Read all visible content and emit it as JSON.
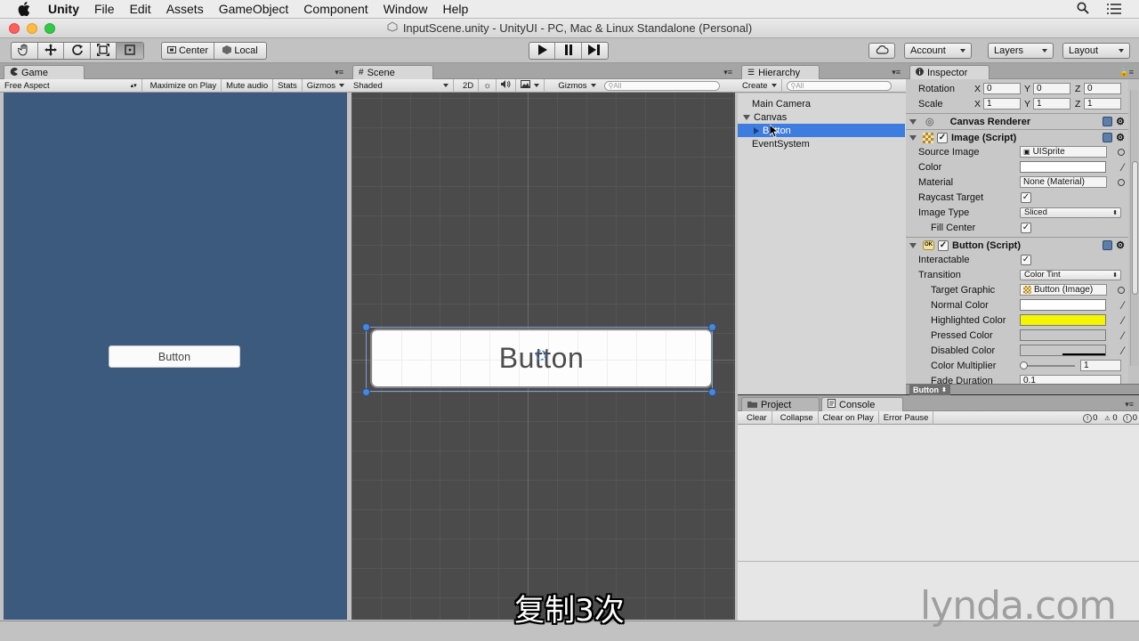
{
  "menubar": {
    "app": "Unity",
    "items": [
      "File",
      "Edit",
      "Assets",
      "GameObject",
      "Component",
      "Window",
      "Help"
    ]
  },
  "window": {
    "title": "InputScene.unity - UnityUI - PC, Mac & Linux Standalone (Personal)"
  },
  "toolbar": {
    "pivot": "Center",
    "space": "Local",
    "account": "Account",
    "layers": "Layers",
    "layout": "Layout"
  },
  "game": {
    "tab": "Game",
    "aspect": "Free Aspect",
    "maximize": "Maximize on Play",
    "mute": "Mute audio",
    "stats": "Stats",
    "gizmos": "Gizmos",
    "button_text": "Button"
  },
  "scene": {
    "tab": "Scene",
    "shading": "Shaded",
    "mode2d": "2D",
    "gizmos": "Gizmos",
    "search_placeholder": "All",
    "button_text": "Button"
  },
  "hierarchy": {
    "tab": "Hierarchy",
    "create": "Create",
    "search_placeholder": "All",
    "items": [
      {
        "label": "Main Camera"
      },
      {
        "label": "Canvas"
      },
      {
        "label": "Button"
      },
      {
        "label": "EventSystem"
      }
    ]
  },
  "inspector": {
    "tab": "Inspector",
    "rotation": {
      "label": "Rotation",
      "x": "0",
      "y": "0",
      "z": "0"
    },
    "scale": {
      "label": "Scale",
      "x": "1",
      "y": "1",
      "z": "1"
    },
    "axis": {
      "x": "X",
      "y": "Y",
      "z": "Z"
    },
    "canvas_renderer": "Canvas Renderer",
    "image_script": {
      "title": "Image (Script)",
      "source_image_label": "Source Image",
      "source_image_value": "UISprite",
      "color_label": "Color",
      "material_label": "Material",
      "material_value": "None (Material)",
      "raycast_label": "Raycast Target",
      "image_type_label": "Image Type",
      "image_type_value": "Sliced",
      "fill_center_label": "Fill Center"
    },
    "button_script": {
      "title": "Button (Script)",
      "interactable_label": "Interactable",
      "transition_label": "Transition",
      "transition_value": "Color Tint",
      "target_graphic_label": "Target Graphic",
      "target_graphic_value": "Button (Image)",
      "normal_color_label": "Normal Color",
      "highlighted_color_label": "Highlighted Color",
      "pressed_color_label": "Pressed Color",
      "disabled_color_label": "Disabled Color",
      "color_multiplier_label": "Color Multiplier",
      "color_multiplier_value": "1",
      "fade_duration_label": "Fade Duration",
      "fade_duration_value": "0.1"
    },
    "footer_label": "Button",
    "colors": {
      "color": "#ffffff",
      "normal": "#ffffff",
      "highlighted": "#f5f500",
      "pressed": "#c8c8c8",
      "disabled": "#c8c8c8"
    }
  },
  "console": {
    "project_tab": "Project",
    "console_tab": "Console",
    "clear": "Clear",
    "collapse": "Collapse",
    "clear_on_play": "Clear on Play",
    "error_pause": "Error Pause",
    "info_count": "0",
    "warn_count": "0",
    "error_count": "0"
  },
  "overlay": {
    "subtitle": "复制3次",
    "watermark": "lynda.com"
  },
  "colors": {
    "game_bg": "#3c5a7e",
    "selection": "#3e7de0"
  }
}
